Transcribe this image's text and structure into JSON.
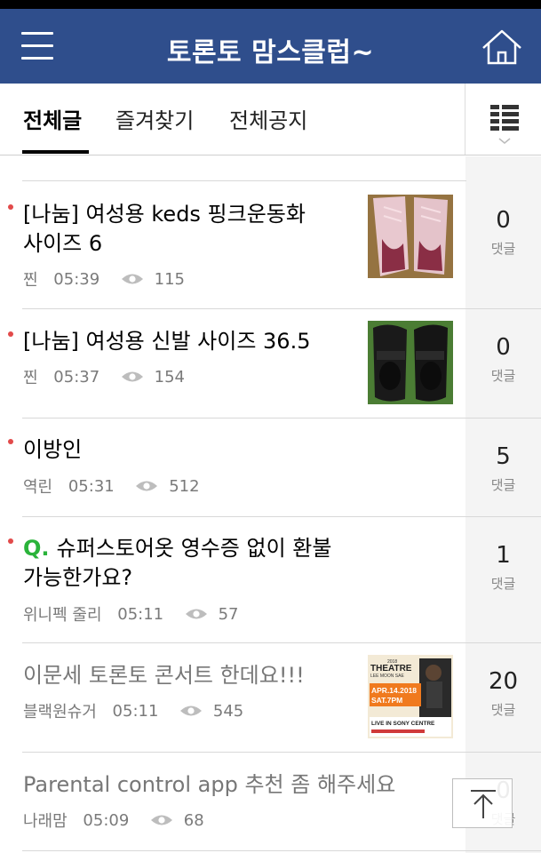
{
  "header": {
    "title": "토론토 맘스클럽~",
    "menu_icon": "hamburger-menu-icon",
    "home_icon": "home-icon"
  },
  "tabs": [
    {
      "label": "전체글",
      "active": true
    },
    {
      "label": "즐겨찾기",
      "active": false
    },
    {
      "label": "전체공지",
      "active": false
    }
  ],
  "colors": {
    "header_bg": "#2f4e8c",
    "new_dot": "#e24a4a",
    "question_mark": "#2ab33a"
  },
  "posts": [
    {
      "title_lines": [
        "[나눔] 여성용 keds 핑크운동화",
        "사이즈 6"
      ],
      "author": "찐",
      "time": "05:39",
      "views": "115",
      "comments": "0",
      "comments_label": "댓글",
      "has_thumbnail": true,
      "new": true
    },
    {
      "title_lines": [
        "[나눔] 여성용 신발 사이즈 36.5"
      ],
      "author": "찐",
      "time": "05:37",
      "views": "154",
      "comments": "0",
      "comments_label": "댓글",
      "has_thumbnail": true,
      "new": true
    },
    {
      "title_lines": [
        "이방인"
      ],
      "author": "역린",
      "time": "05:31",
      "views": "512",
      "comments": "5",
      "comments_label": "댓글",
      "has_thumbnail": false,
      "new": true
    },
    {
      "question_prefix": "Q.",
      "title_lines": [
        "슈퍼스토어옷 영수증 없이 환불",
        "가능한가요?"
      ],
      "author": "위니펙 줄리",
      "time": "05:11",
      "views": "57",
      "comments": "1",
      "comments_label": "댓글",
      "has_thumbnail": false,
      "new": true
    },
    {
      "title_lines": [
        "이문세 토론토 콘서트 한데요!!!"
      ],
      "author": "블랙원슈거",
      "time": "05:11",
      "views": "545",
      "comments": "20",
      "comments_label": "댓글",
      "has_thumbnail": true,
      "new": false,
      "thumbnail_text": {
        "year": "2018",
        "headline": "THEATRE",
        "artist": "LEE MOON SAE",
        "date": "APR.14.2018",
        "time": "SAT.7PM",
        "venue": "LIVE IN SONY CENTRE"
      }
    },
    {
      "title_lines": [
        "Parental control app 추천 좀 해주세요"
      ],
      "author": "나래맘",
      "time": "05:09",
      "views": "68",
      "comments": "0",
      "comments_label": "댓글",
      "has_thumbnail": false,
      "new": false
    }
  ],
  "scroll_top_icon": "arrow-up-to-top-icon"
}
